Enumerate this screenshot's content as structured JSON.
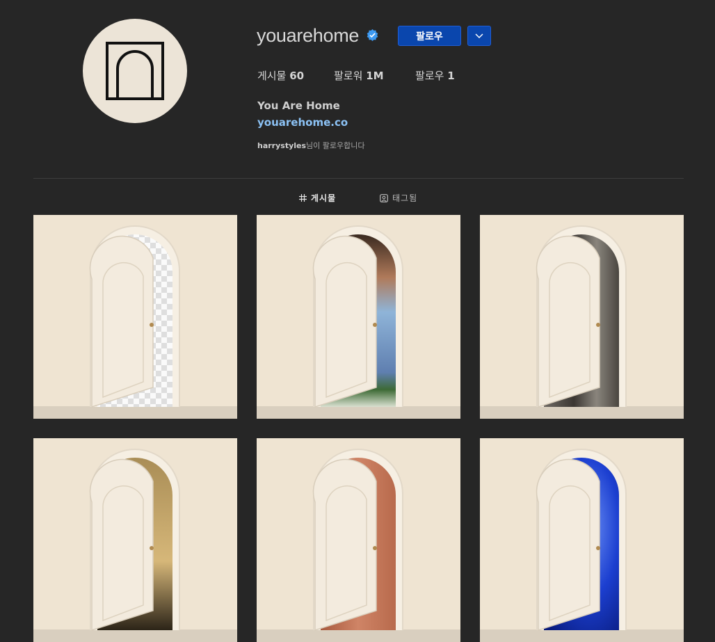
{
  "profile": {
    "username": "youarehome",
    "follow_label": "팔로우",
    "stats": {
      "posts_label": "게시물",
      "posts_value": "60",
      "followers_label": "팔로워",
      "followers_value": "1M",
      "following_label": "팔로우",
      "following_value": "1"
    },
    "full_name": "You Are Home",
    "website": "youarehome.co",
    "followed_by_user": "harrystyles",
    "followed_by_suffix": "님이 팔로우합니다"
  },
  "tabs": [
    {
      "label": "게시물",
      "icon": "grid-icon",
      "active": true
    },
    {
      "label": "태그됨",
      "icon": "tag-icon",
      "active": false
    }
  ],
  "colors": {
    "background": "#262626",
    "accent": "#0a46ad",
    "link": "#8cc2f5",
    "tile_bg": "#efe4d2"
  },
  "posts": [
    {
      "id": "post-1",
      "through_door": "transparency-checkerboard"
    },
    {
      "id": "post-2",
      "through_door": "person-portrait"
    },
    {
      "id": "post-3",
      "through_door": "wooden-fence"
    },
    {
      "id": "post-4",
      "through_door": "desert-shadow"
    },
    {
      "id": "post-5",
      "through_door": "skin-closeup"
    },
    {
      "id": "post-6",
      "through_door": "jellyfish"
    }
  ]
}
